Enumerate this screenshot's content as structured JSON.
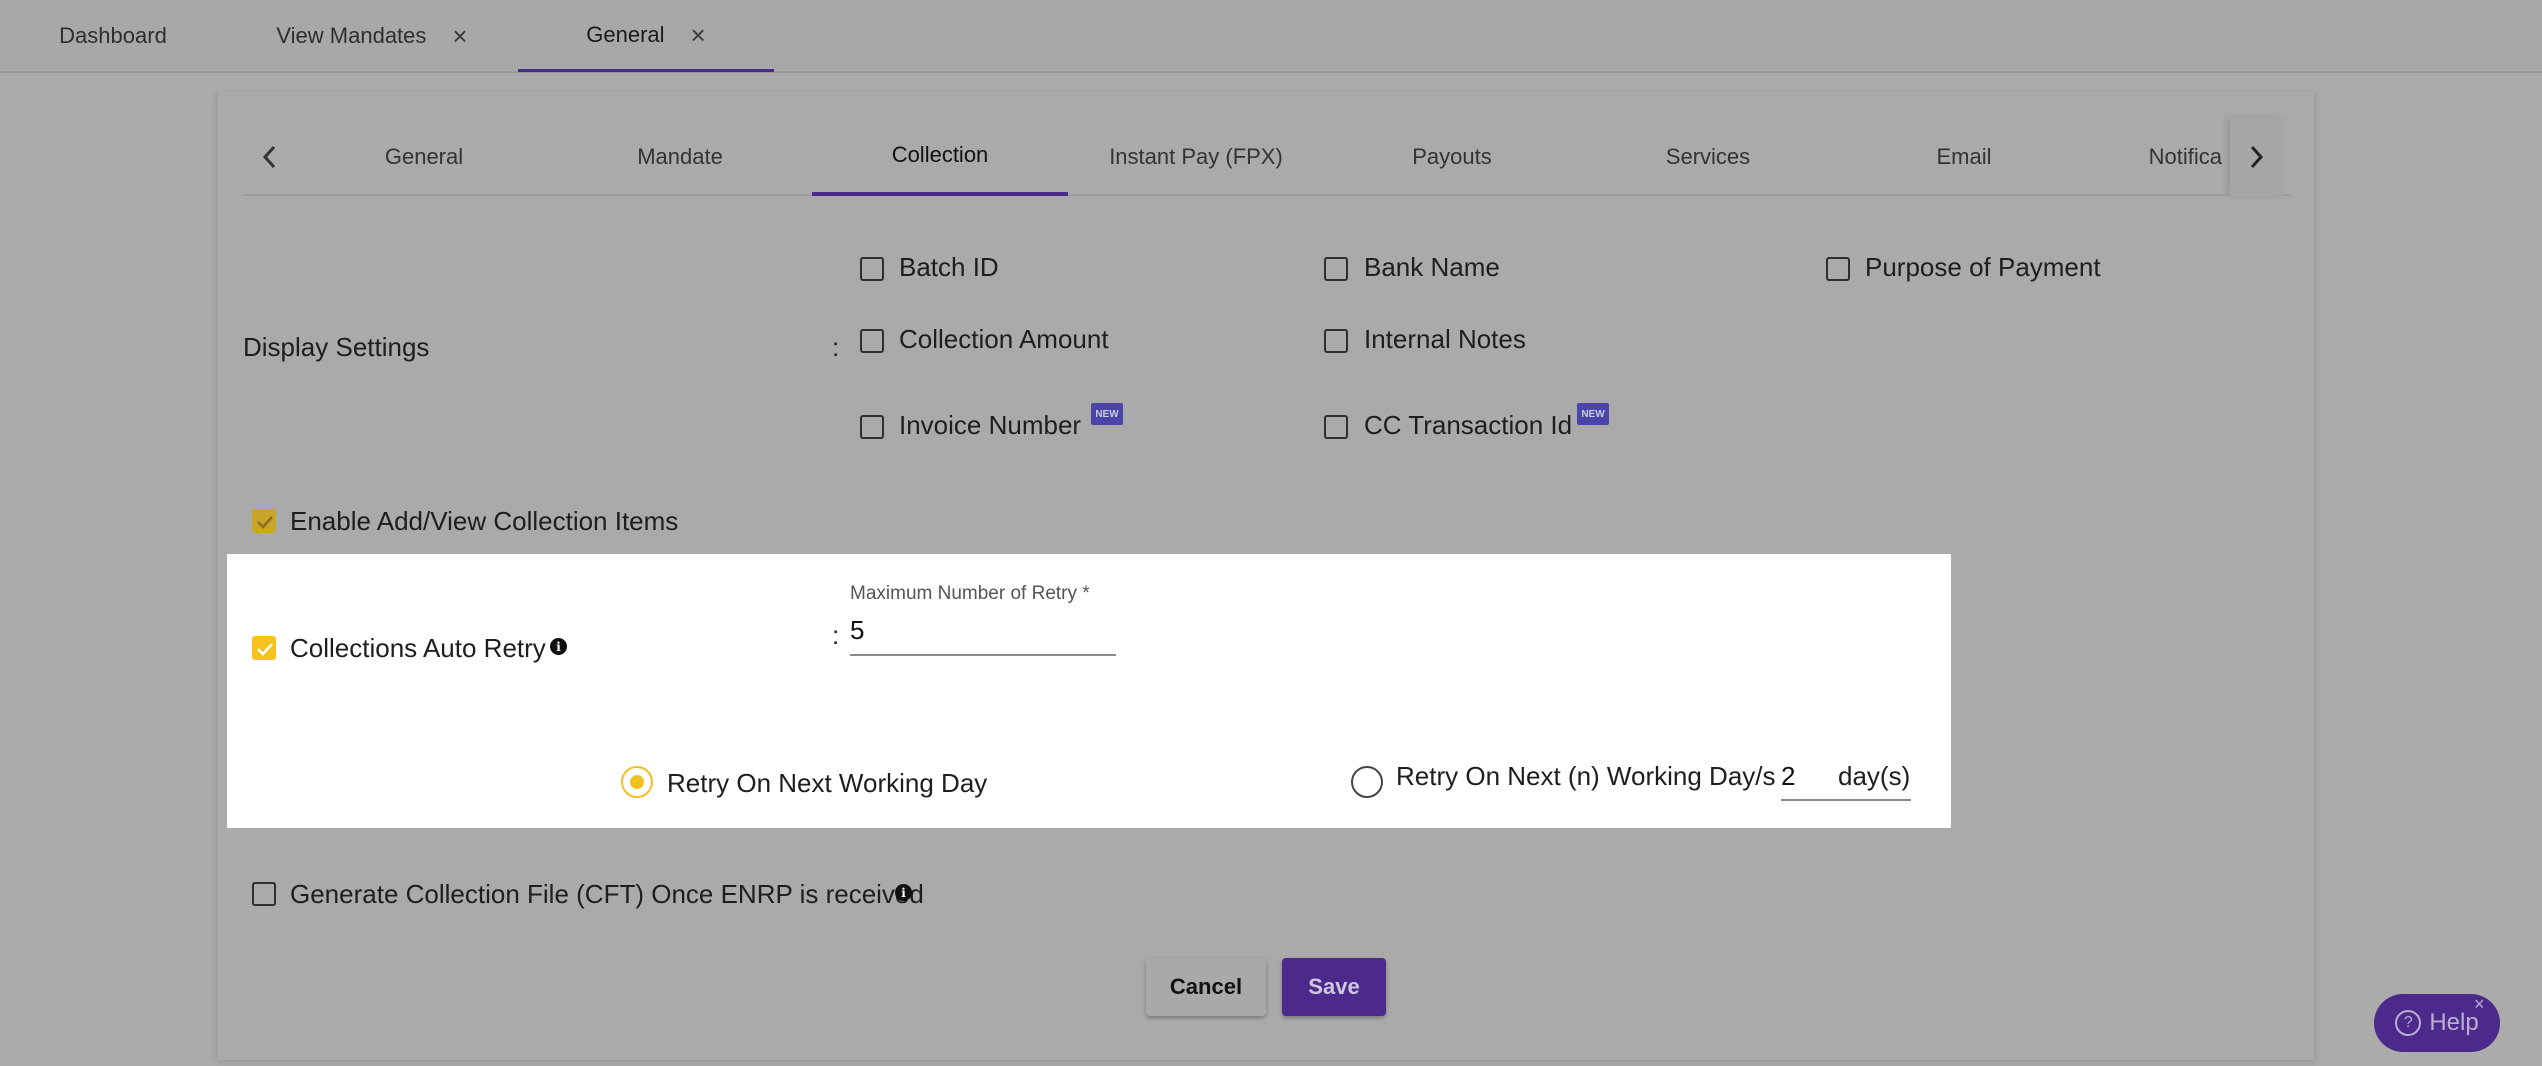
{
  "top_tabs": [
    {
      "label": "Dashboard"
    },
    {
      "label": "View Mandates",
      "close": "×"
    },
    {
      "label": "General",
      "close": "×"
    }
  ],
  "sub_tabs": [
    "General",
    "Mandate",
    "Collection",
    "Instant Pay (FPX)",
    "Payouts",
    "Services",
    "Email",
    "Notifica"
  ],
  "active_sub_tab": "Collection",
  "display_settings": {
    "label": "Display Settings",
    "colon": ":",
    "options": {
      "batch_id": "Batch ID",
      "bank_name": "Bank Name",
      "purpose_of_payment": "Purpose of Payment",
      "collection_amount": "Collection Amount",
      "internal_notes": "Internal Notes",
      "invoice_number": "Invoice Number",
      "cc_transaction_id": "CC Transaction Id"
    },
    "new_badge": "NEW"
  },
  "enable_add_view": {
    "label": "Enable Add/View Collection Items",
    "checked": true
  },
  "auto_retry": {
    "label": "Collections Auto Retry",
    "checked": true,
    "info": "i",
    "colon": ":",
    "max_retry_label": "Maximum Number of Retry *",
    "max_retry_value": "5",
    "option_next_day": "Retry On Next Working Day",
    "option_next_n": "Retry On Next (n) Working Day/s",
    "n_days_value": "2",
    "days_unit": "day(s)",
    "selected_option": "next_day"
  },
  "generate_cft": {
    "label": "Generate Collection File (CFT) Once ENRP is received",
    "checked": false,
    "info": "i"
  },
  "buttons": {
    "cancel": "Cancel",
    "save": "Save"
  },
  "help": {
    "label": "Help",
    "close": "×"
  },
  "colors": {
    "primary": "#4b2a8c",
    "accent": "#f0c020"
  }
}
